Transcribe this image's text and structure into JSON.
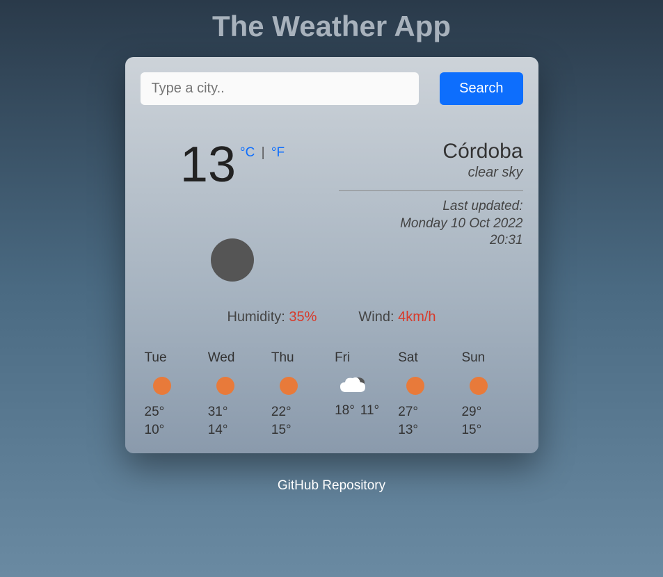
{
  "app": {
    "title": "The Weather App"
  },
  "search": {
    "placeholder": "Type a city..",
    "button": "Search"
  },
  "current": {
    "temp": "13",
    "unit_c": "°C",
    "unit_sep": "|",
    "unit_f": "°F",
    "city": "Córdoba",
    "condition": "clear sky",
    "updated_label": "Last updated:",
    "updated_date": "Monday 10 Oct 2022",
    "updated_time": "20:31",
    "icon": "clear-night"
  },
  "metrics": {
    "humidity_label": "Humidity: ",
    "humidity_value": "35%",
    "wind_label": "Wind: ",
    "wind_value": "4km/h"
  },
  "forecast": [
    {
      "day": "Tue",
      "icon": "sun",
      "high": "25°",
      "low": "10°",
      "inline": false
    },
    {
      "day": "Wed",
      "icon": "sun",
      "high": "31°",
      "low": "14°",
      "inline": false
    },
    {
      "day": "Thu",
      "icon": "sun",
      "high": "22°",
      "low": "15°",
      "inline": false
    },
    {
      "day": "Fri",
      "icon": "cloud",
      "high": "18°",
      "low": "11°",
      "inline": true
    },
    {
      "day": "Sat",
      "icon": "sun",
      "high": "27°",
      "low": "13°",
      "inline": false
    },
    {
      "day": "Sun",
      "icon": "sun",
      "high": "29°",
      "low": "15°",
      "inline": false
    }
  ],
  "footer": {
    "link": "GitHub Repository"
  }
}
